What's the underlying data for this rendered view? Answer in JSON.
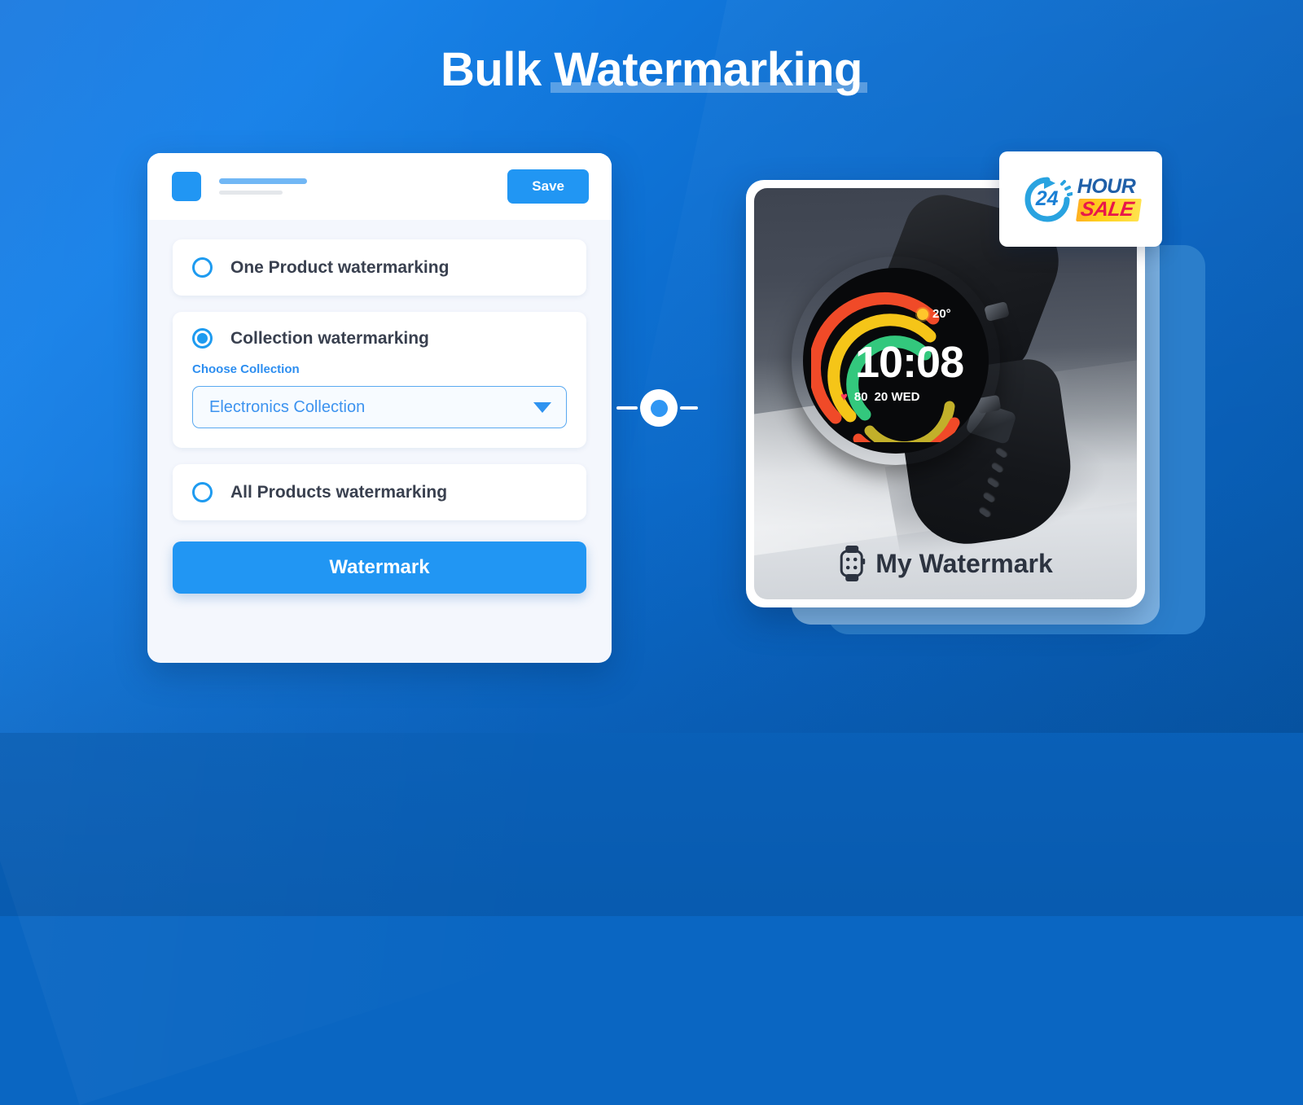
{
  "page": {
    "title_light": "Bulk ",
    "title_strong": "Watermarking"
  },
  "panel": {
    "header": {
      "logo_icon": "app-logo-square",
      "save_label": "Save"
    },
    "options": [
      {
        "label": "One Product watermarking",
        "selected": false
      },
      {
        "label": "Collection watermarking",
        "selected": true
      },
      {
        "label": "All Products watermarking",
        "selected": false
      }
    ],
    "collection": {
      "field_label": "Choose Collection",
      "selected_value": "Electronics Collection",
      "caret_icon": "chevron-down-icon"
    },
    "primary_action": "Watermark"
  },
  "connector": {
    "dot_icon": "connector-dot-icon"
  },
  "preview": {
    "watermark_text": "My Watermark",
    "watermark_icon": "smartwatch-icon",
    "watch_face": {
      "time": "10:08",
      "temperature": "20°",
      "weather_icon": "sun-icon",
      "heart_icon": "♥",
      "heart_rate": "80",
      "date": "20 WED"
    }
  },
  "sale_badge": {
    "hours": "24",
    "hour_label": "HOUR",
    "sale_label": "SALE",
    "arrow_icon": "circular-arrow-icon"
  },
  "colors": {
    "accent": "#2196f3",
    "accent_light": "#5aa9f0",
    "background_blue": "#0d6fd1",
    "text_dark": "#39404f",
    "sale_red": "#e8174a",
    "sale_yellow": "#ffd21e"
  }
}
